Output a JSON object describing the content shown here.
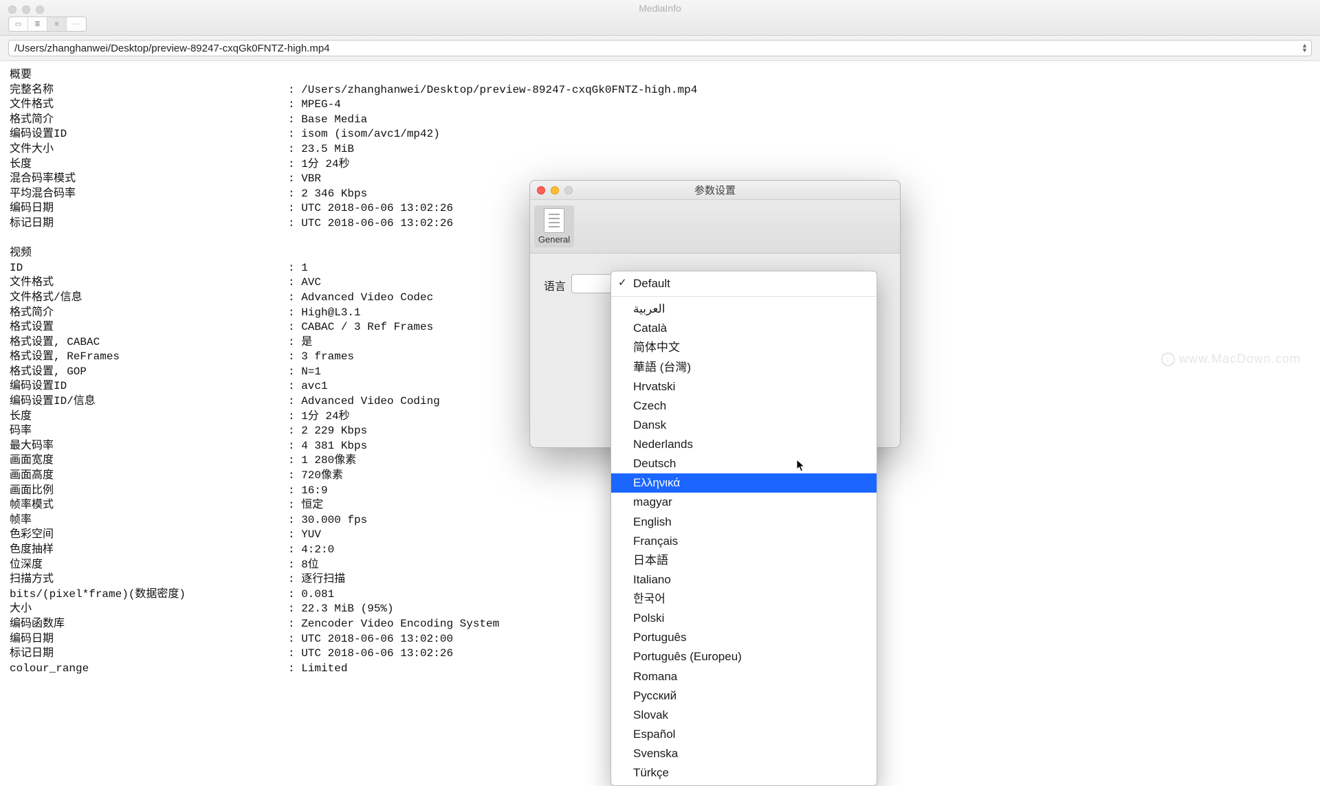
{
  "window": {
    "title": "MediaInfo"
  },
  "path": "/Users/zhanghanwei/Desktop/preview-89247-cxqGk0FNTZ-high.mp4",
  "sections": {
    "general": {
      "header": "概要",
      "rows": [
        {
          "k": "完整名称",
          "v": "/Users/zhanghanwei/Desktop/preview-89247-cxqGk0FNTZ-high.mp4"
        },
        {
          "k": "文件格式",
          "v": "MPEG-4"
        },
        {
          "k": "格式简介",
          "v": "Base Media"
        },
        {
          "k": "编码设置ID",
          "v": "isom (isom/avc1/mp42)"
        },
        {
          "k": "文件大小",
          "v": "23.5 MiB"
        },
        {
          "k": "长度",
          "v": "1分 24秒"
        },
        {
          "k": "混合码率模式",
          "v": "VBR"
        },
        {
          "k": "平均混合码率",
          "v": "2 346 Kbps"
        },
        {
          "k": "编码日期",
          "v": "UTC 2018-06-06 13:02:26"
        },
        {
          "k": "标记日期",
          "v": "UTC 2018-06-06 13:02:26"
        }
      ]
    },
    "video": {
      "header": "视频",
      "rows": [
        {
          "k": "ID",
          "v": "1"
        },
        {
          "k": "文件格式",
          "v": "AVC"
        },
        {
          "k": "文件格式/信息",
          "v": "Advanced Video Codec"
        },
        {
          "k": "格式简介",
          "v": "High@L3.1"
        },
        {
          "k": "格式设置",
          "v": "CABAC / 3 Ref Frames"
        },
        {
          "k": "格式设置, CABAC",
          "v": "是"
        },
        {
          "k": "格式设置, ReFrames",
          "v": "3 frames"
        },
        {
          "k": "格式设置, GOP",
          "v": "N=1"
        },
        {
          "k": "编码设置ID",
          "v": "avc1"
        },
        {
          "k": "编码设置ID/信息",
          "v": "Advanced Video Coding"
        },
        {
          "k": "长度",
          "v": "1分 24秒"
        },
        {
          "k": "码率",
          "v": "2 229 Kbps"
        },
        {
          "k": "最大码率",
          "v": "4 381 Kbps"
        },
        {
          "k": "画面宽度",
          "v": "1 280像素"
        },
        {
          "k": "画面高度",
          "v": "720像素"
        },
        {
          "k": "画面比例",
          "v": "16:9"
        },
        {
          "k": "帧率模式",
          "v": "恒定"
        },
        {
          "k": "帧率",
          "v": "30.000 fps"
        },
        {
          "k": "色彩空间",
          "v": "YUV"
        },
        {
          "k": "色度抽样",
          "v": "4:2:0"
        },
        {
          "k": "位深度",
          "v": "8位"
        },
        {
          "k": "扫描方式",
          "v": "逐行扫描"
        },
        {
          "k": "bits/(pixel*frame)(数据密度)",
          "v": "0.081"
        },
        {
          "k": "大小",
          "v": "22.3 MiB (95%)"
        },
        {
          "k": "编码函数库",
          "v": "Zencoder Video Encoding System"
        },
        {
          "k": "编码日期",
          "v": "UTC 2018-06-06 13:02:00"
        },
        {
          "k": "标记日期",
          "v": "UTC 2018-06-06 13:02:26"
        },
        {
          "k": "colour_range",
          "v": "Limited"
        }
      ]
    }
  },
  "prefs": {
    "title": "参数设置",
    "tab_general": "General",
    "language_label": "语言",
    "selected": "Default",
    "options": [
      "Default",
      "العربية",
      "Català",
      "简体中文",
      "華語 (台灣)",
      "Hrvatski",
      "Czech",
      "Dansk",
      "Nederlands",
      "Deutsch",
      "Ελληνικά",
      "magyar",
      "English",
      "Français",
      "日本語",
      "Italiano",
      "한국어",
      "Polski",
      "Português",
      "Português (Europeu)",
      "Romana",
      "Русский",
      "Slovak",
      "Español",
      "Svenska",
      "Türkçe"
    ],
    "highlight_index": 10
  },
  "watermark": "www.MacDown.com"
}
